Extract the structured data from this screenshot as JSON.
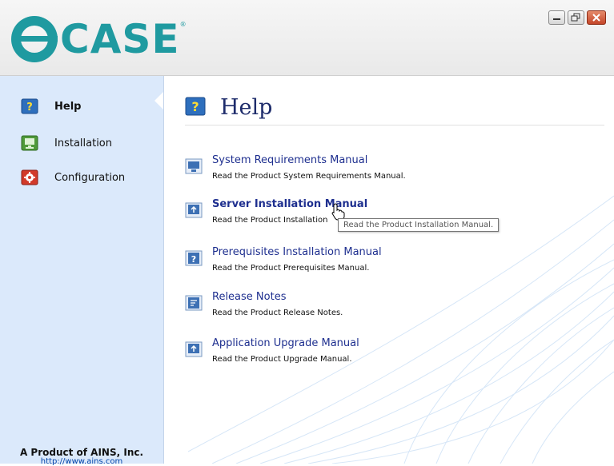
{
  "app": {
    "logo_text": "CASE",
    "logo_mark": "e"
  },
  "window_controls": [
    "minimize",
    "restore",
    "close"
  ],
  "sidebar": {
    "items": [
      {
        "label": "Help",
        "icon": "help-icon",
        "active": true
      },
      {
        "label": "Installation",
        "icon": "installation-icon",
        "active": false
      },
      {
        "label": "Configuration",
        "icon": "configuration-icon",
        "active": false
      }
    ],
    "footer_company": "A Product of AINS, Inc.",
    "footer_url": "http://www.ains.com"
  },
  "main": {
    "title": "Help",
    "documents": [
      {
        "title": "System Requirements Manual",
        "description": "Read the Product System Requirements Manual.",
        "icon": "monitor-doc-icon"
      },
      {
        "title": "Server Installation Manual",
        "description": "Read the Product Installation Manual.",
        "icon": "server-doc-icon"
      },
      {
        "title": "Prerequisites Installation Manual",
        "description": "Read the Product Prerequisites Manual.",
        "icon": "prerequisites-doc-icon"
      },
      {
        "title": "Release Notes",
        "description": "Read the Product Release Notes.",
        "icon": "release-notes-doc-icon"
      },
      {
        "title": "Application Upgrade Manual",
        "description": "Read the Product Upgrade Manual.",
        "icon": "upgrade-doc-icon"
      }
    ],
    "tooltip": "Read the Product Installation Manual.",
    "tooltip_visible_prefix": "Read the Product Installation"
  },
  "colors": {
    "brand": "#1f9aa0",
    "sidebar_bg": "#dbe9fb",
    "link": "#1e2f8f",
    "title": "#1e2c6b"
  }
}
